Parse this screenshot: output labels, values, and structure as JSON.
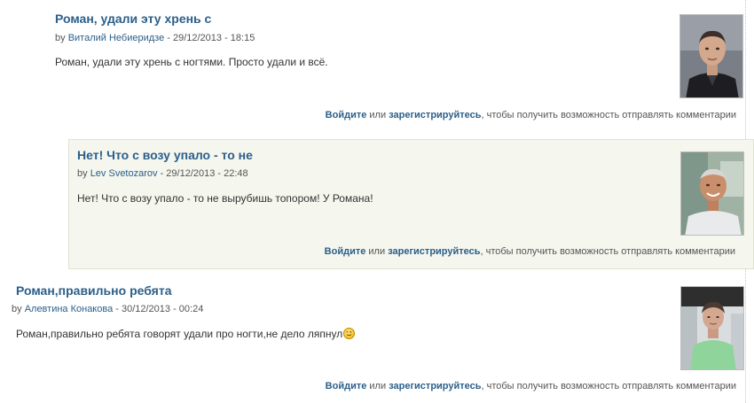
{
  "comments": [
    {
      "title": "Роман, удали эту хрень с",
      "by": "by",
      "author": "Виталий Небиеридзе",
      "date": " - 29/12/2013 - 18:15",
      "body": "Роман, удали эту хрень с ногтями. Просто удали и всё.",
      "avatar_icon": "user-photo-icon"
    },
    {
      "title": "Нет! Что с возу упало - то не",
      "by": "by",
      "author": "Lev Svetozarov",
      "date": " - 29/12/2013 - 22:48",
      "body": "Нет! Что с возу упало - то не вырубишь топором! У Романа!",
      "avatar_icon": "user-photo-icon"
    },
    {
      "title": "Роман,правильно ребята",
      "by": "by",
      "author": "Алевтина Конакова",
      "date": " - 30/12/2013 - 00:24",
      "body": "Роман,правильно ребята говорят удали про ногти,не дело ляпнул",
      "emoji": "wink-smiley-icon",
      "avatar_icon": "user-photo-icon"
    }
  ],
  "links": {
    "login": "Войдите",
    "or": " или ",
    "register": "зарегистрируйтесь",
    "suffix": ", чтобы получить возможность отправлять комментарии"
  },
  "colors": {
    "link": "#2b5f8a",
    "reply_background": "#f5f6ee"
  }
}
